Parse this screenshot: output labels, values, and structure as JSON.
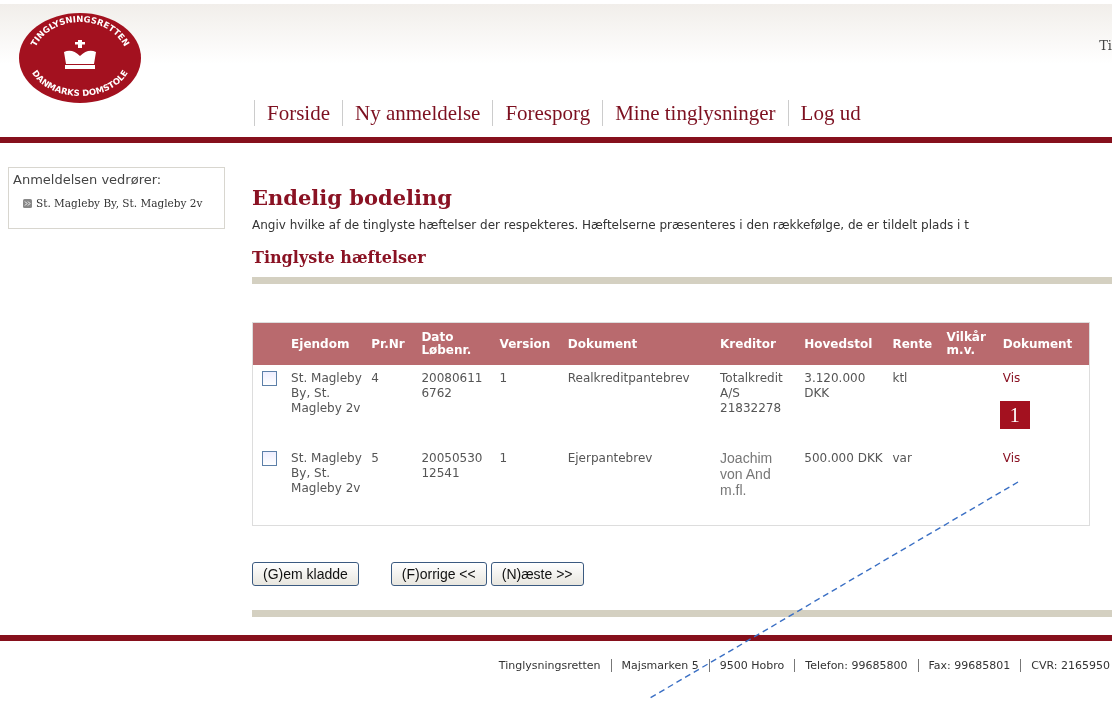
{
  "header": {
    "logo": {
      "top_text": "TINGLYSNINGSRETTEN",
      "bottom_text": "DANMARKS DOMSTOLE"
    },
    "corner_text": "Ti"
  },
  "nav": [
    "Forside",
    "Ny anmeldelse",
    "Foresporg",
    "Mine tinglysninger",
    "Log ud"
  ],
  "sidebar": {
    "label": "Anmeldelsen vedrører:",
    "items": [
      "St. Magleby By, St. Magleby 2v"
    ]
  },
  "page": {
    "title": "Endelig bodeling",
    "description": "Angiv hvilke af de tinglyste hæftelser der respekteres. Hæftelserne præsenteres i den rækkefølge, de er tildelt plads i t",
    "section_title": "Tinglyste hæftelser"
  },
  "table": {
    "columns": [
      "Ejendom",
      "Pr.Nr",
      "Dato Løbenr.",
      "Version",
      "Dokument",
      "Kreditor",
      "Hovedstol",
      "Rente",
      "Vilkår m.v.",
      "Dokument"
    ],
    "rows": [
      {
        "checked": false,
        "cells": [
          "St. Magleby By, St. Magleby 2v",
          "4",
          "20080611 6762",
          "1",
          "Realkreditpantebrev",
          "Totalkredit A/S 21832278",
          "3.120.000 DKK",
          "ktl",
          ""
        ],
        "link": "Vis"
      },
      {
        "checked": false,
        "cells": [
          "St. Magleby By, St. Magleby 2v",
          "5",
          "20050530 12541",
          "1",
          "Ejerpantebrev",
          "Joachim von And m.fl.",
          "500.000 DKK",
          "var",
          ""
        ],
        "link": "Vis"
      }
    ]
  },
  "callout": "1",
  "buttons": [
    "(G)em kladde",
    "(F)orrige <<",
    "(N)æste >>"
  ],
  "footer": [
    "Tinglysningsretten",
    "Majsmarken 5",
    "9500 Hobro",
    "Telefon: 99685800",
    "Fax: 99685801",
    "CVR: 2165950"
  ]
}
